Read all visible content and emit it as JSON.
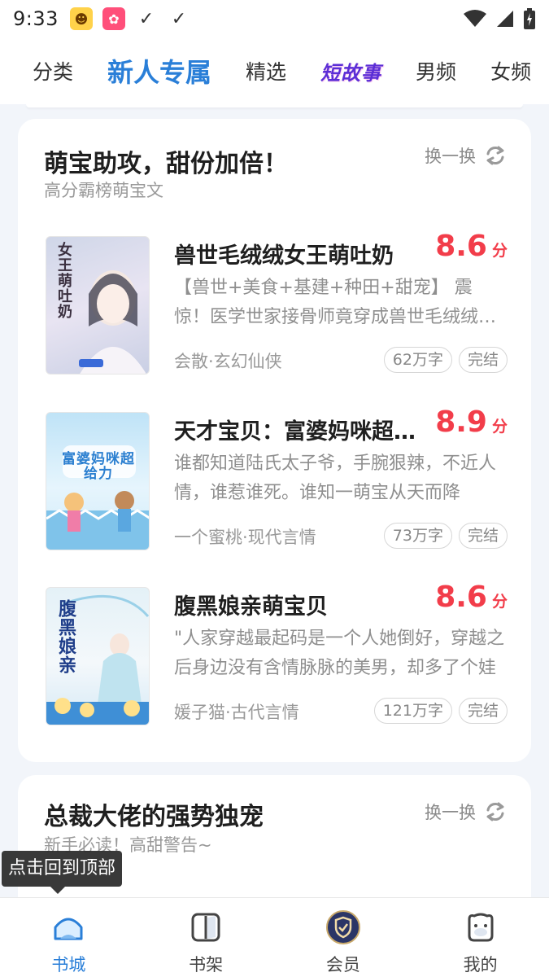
{
  "status_bar": {
    "time": "9:33"
  },
  "top_nav": {
    "tabs": [
      {
        "label": "分类"
      },
      {
        "label": "新人专属"
      },
      {
        "label": "精选"
      },
      {
        "label": "短故事"
      },
      {
        "label": "男频"
      },
      {
        "label": "女频"
      }
    ],
    "active_index": 1
  },
  "section1": {
    "title": "萌宝助攻，甜份加倍！",
    "subtitle": "高分霸榜萌宝文",
    "refresh_label": "换一换",
    "books": [
      {
        "title": "兽世毛绒绒女王萌吐奶",
        "score": "8.6",
        "score_unit": "分",
        "desc": "【兽世+美食+基建+种田+甜宠】 震惊！医学世家接骨师竟穿成兽世毛绒绒女王萌吐奶",
        "meta": "会散·玄幻仙侠",
        "words": "62万字",
        "status": "完结",
        "cover_text": "女王萌吐奶"
      },
      {
        "title": "天才宝贝：富婆妈咪超给力",
        "score": "8.9",
        "score_unit": "分",
        "desc": "谁都知道陆氏太子爷，手腕狠辣，不近人情，谁惹谁死。谁知一萌宝从天而降",
        "meta": "一个蜜桃·现代言情",
        "words": "73万字",
        "status": "完结",
        "cover_text": "富婆妈咪超给力"
      },
      {
        "title": "腹黑娘亲萌宝贝",
        "score": "8.6",
        "score_unit": "分",
        "desc": "\"人家穿越最起码是一个人她倒好，穿越之后身边没有含情脉脉的美男，却多了个娃",
        "meta": "媛子猫·古代言情",
        "words": "121万字",
        "status": "完结",
        "cover_text": "腹黑娘亲"
      }
    ]
  },
  "section2": {
    "title": "总裁大佬的强势独宠",
    "subtitle": "新手必读！高甜警告~",
    "refresh_label": "换一换"
  },
  "tooltip": {
    "text": "点击回到顶部"
  },
  "bottom_nav": {
    "items": [
      {
        "label": "书城"
      },
      {
        "label": "书架"
      },
      {
        "label": "会员"
      },
      {
        "label": "我的"
      }
    ],
    "active_index": 0
  },
  "colors": {
    "accent": "#2a7fd8",
    "score": "#f23d4a",
    "page_bg": "#f2f5fa"
  }
}
